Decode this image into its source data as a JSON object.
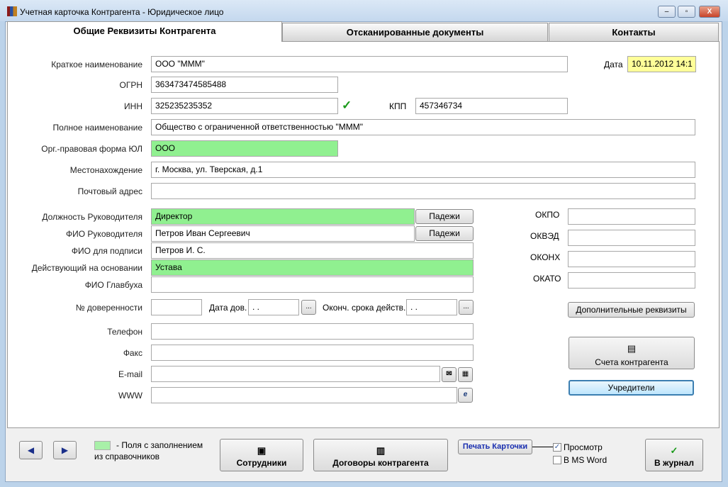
{
  "window": {
    "title": "Учетная карточка Контрагента - Юридическое лицо",
    "min": "–",
    "max": "▫",
    "close": "X"
  },
  "tabs": [
    {
      "label": "Общие Реквизиты Контрагента"
    },
    {
      "label": "Отсканированные документы"
    },
    {
      "label": "Контакты"
    }
  ],
  "form": {
    "short_name": {
      "label": "Краткое наименование",
      "value": "ООО \"МММ\""
    },
    "date": {
      "label": "Дата",
      "value": "10.11.2012 14:1"
    },
    "ogrn": {
      "label": "ОГРН",
      "value": "363473474585488"
    },
    "inn": {
      "label": "ИНН",
      "value": "325235235352",
      "check": "✓"
    },
    "kpp": {
      "label": "КПП",
      "value": "457346734"
    },
    "full_name": {
      "label": "Полное наименование",
      "value": "Общество с ограниченной ответственностью \"МММ\""
    },
    "org_form": {
      "label": "Орг.-правовая форма ЮЛ",
      "value": "ООО"
    },
    "location": {
      "label": "Местонахождение",
      "value": "г. Москва, ул. Тверская, д.1"
    },
    "postal": {
      "label": "Почтовый адрес",
      "value": ""
    },
    "head_position": {
      "label": "Должность Руководителя",
      "value": "Директор",
      "button": "Падежи"
    },
    "head_name": {
      "label": "ФИО Руководителя",
      "value": "Петров Иван Сергеевич",
      "button": "Падежи"
    },
    "sign_name": {
      "label": "ФИО для подписи",
      "value": "Петров И. С."
    },
    "basis": {
      "label": "Действующий на основании",
      "value": "Устава"
    },
    "accountant": {
      "label": "ФИО Главбуха",
      "value": ""
    },
    "poa_number": {
      "label": "№ доверенности",
      "value": ""
    },
    "poa_date": {
      "label": "Дата дов.",
      "value": "  .  .",
      "button": "..."
    },
    "poa_end": {
      "label": "Оконч. срока действ.",
      "value": "  .  .",
      "button": "..."
    },
    "phone": {
      "label": "Телефон",
      "value": ""
    },
    "fax": {
      "label": "Факс",
      "value": ""
    },
    "email": {
      "label": "E-mail",
      "value": ""
    },
    "www": {
      "label": "WWW",
      "value": ""
    },
    "okpo": {
      "label": "ОКПО",
      "value": ""
    },
    "okved": {
      "label": "ОКВЭД",
      "value": ""
    },
    "okonh": {
      "label": "ОКОНХ",
      "value": ""
    },
    "okato": {
      "label": "ОКАТО",
      "value": ""
    },
    "extra_button": "Дополнительные реквизиты",
    "accounts_button": "Счета контрагента",
    "founders_button": "Учредители"
  },
  "footer": {
    "prev": "◀",
    "next": "▶",
    "legend_line1": "- Поля с заполнением",
    "legend_line2": "из справочников",
    "employees": "Сотрудники",
    "contracts": "Договоры контрагента",
    "print": "Печать Карточки",
    "preview": {
      "label": "Просмотр",
      "checked": true
    },
    "msword": {
      "label": "В MS Word",
      "checked": false
    },
    "journal": "В журнал",
    "journal_icon": "✓"
  },
  "colors": {
    "lookup": "#90f090",
    "date": "#ffff99"
  }
}
